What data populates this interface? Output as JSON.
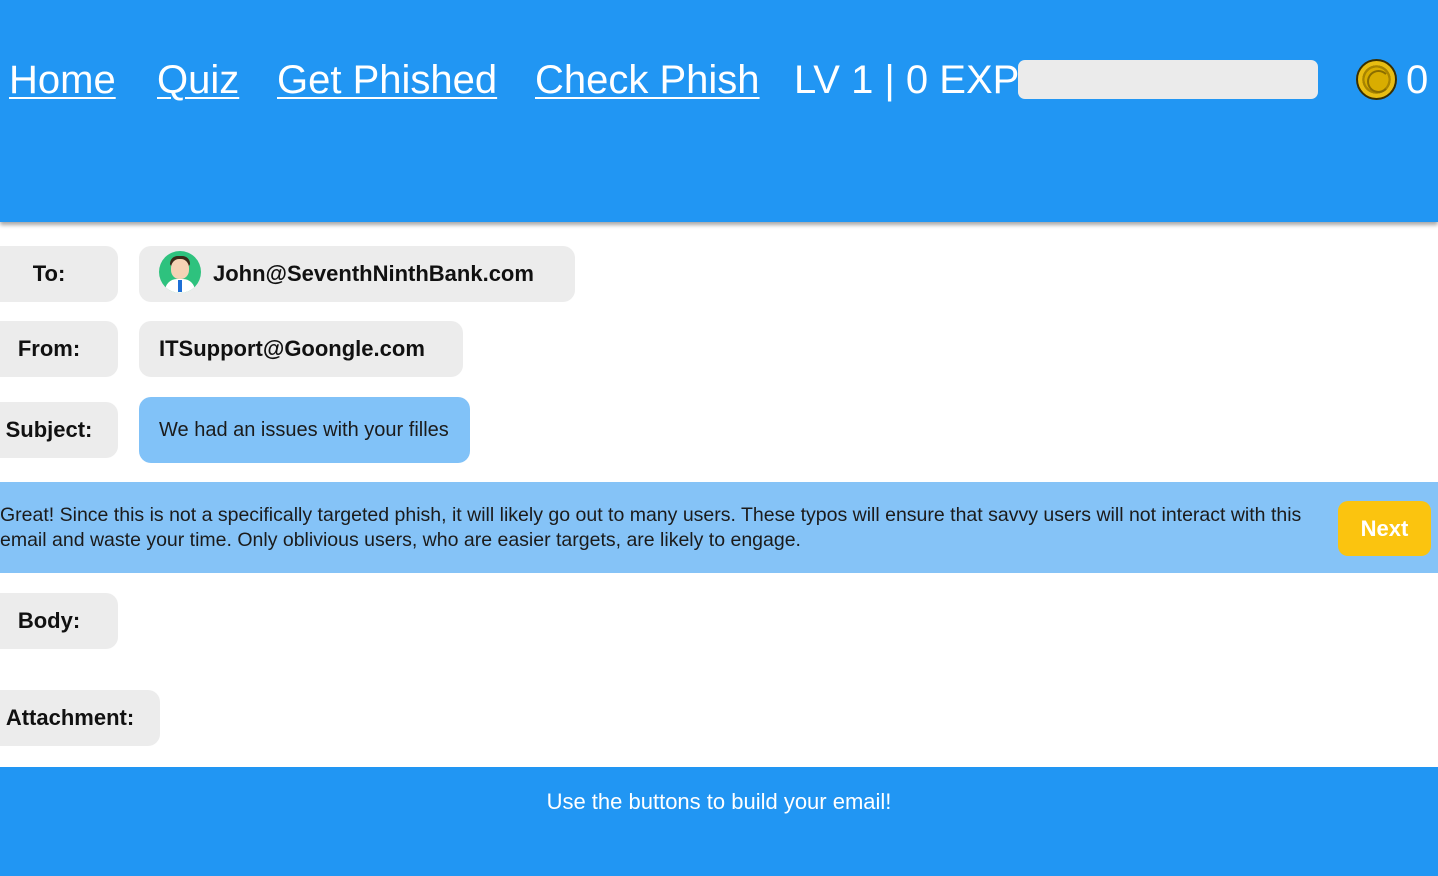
{
  "nav": {
    "home": "Home",
    "quiz": "Quiz",
    "get_phished": "Get Phished",
    "check_phish": "Check Phish"
  },
  "player": {
    "level_text": "LV 1 | 0 EXP",
    "exp_progress": 0,
    "coins": "0"
  },
  "email": {
    "to_label": "To:",
    "to_value": "John@SeventhNinthBank.com",
    "from_label": "From:",
    "from_value": "ITSupport@Goongle.com",
    "subject_label": "Subject:",
    "subject_value": "We had an issues with your filles",
    "body_label": "Body:",
    "attachment_label": "Attachment:"
  },
  "hint": {
    "text": "Great! Since this is not a specifically targeted phish, it will likely go out to many users. These typos will ensure that savvy users will not interact with this email and waste your time. Only oblivious users, who are easier targets, are likely to engage.",
    "next_label": "Next"
  },
  "footer": {
    "text": "Use the buttons to build your email!"
  },
  "colors": {
    "header": "#2196f3",
    "hint_bar": "#85c3f7",
    "subject_highlight": "#81c2f8",
    "next_button": "#fbc40f",
    "pill": "#ececec"
  }
}
